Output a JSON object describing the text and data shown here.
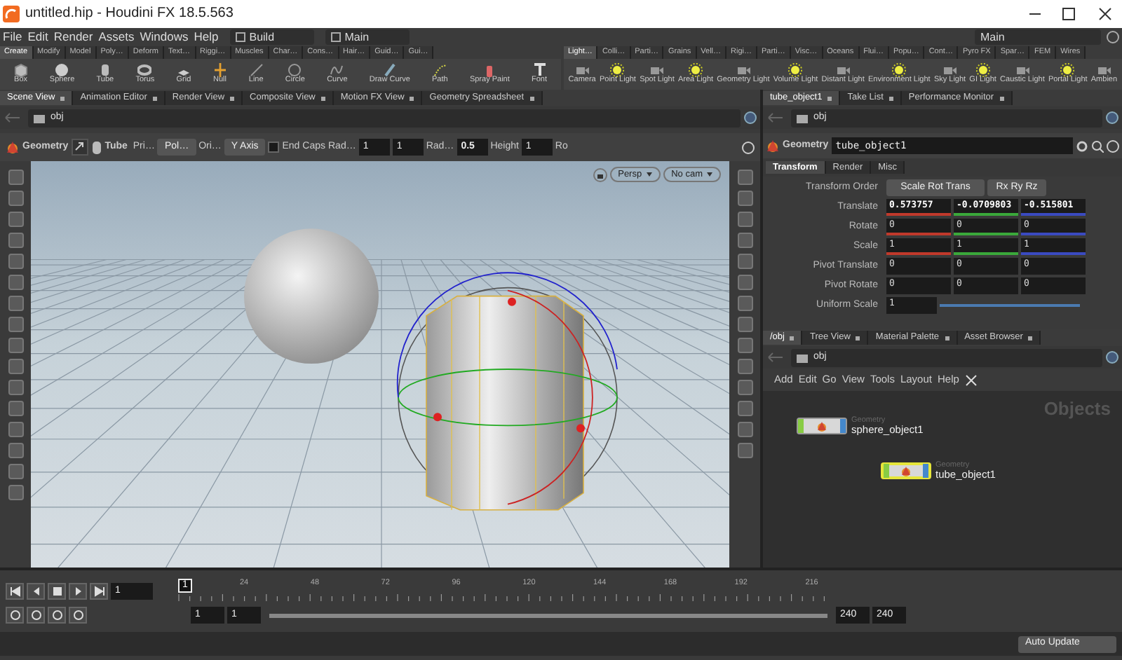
{
  "window": {
    "title": "untitled.hip - Houdini FX 18.5.563"
  },
  "menu": [
    "File",
    "Edit",
    "Render",
    "Assets",
    "Windows",
    "Help"
  ],
  "desktop_selectors": [
    {
      "label": "Build"
    },
    {
      "label": "Main"
    }
  ],
  "right_selector": {
    "label": "Main"
  },
  "shelf_left": {
    "tabs": [
      {
        "label": "Create",
        "selected": true
      },
      {
        "label": "Modify",
        "selected": false
      },
      {
        "label": "Model",
        "selected": false
      },
      {
        "label": "Poly…",
        "selected": false
      },
      {
        "label": "Deform",
        "selected": false
      },
      {
        "label": "Text…",
        "selected": false
      },
      {
        "label": "Riggi…",
        "selected": false
      },
      {
        "label": "Muscles",
        "selected": false
      },
      {
        "label": "Char…",
        "selected": false
      },
      {
        "label": "Cons…",
        "selected": false
      },
      {
        "label": "Hair…",
        "selected": false
      },
      {
        "label": "Guid…",
        "selected": false
      },
      {
        "label": "Gui…",
        "selected": false
      }
    ],
    "tools": [
      "Box",
      "Sphere",
      "Tube",
      "Torus",
      "Grid",
      "Null",
      "Line",
      "Circle",
      "Curve",
      "Draw Curve",
      "Path",
      "Spray Paint",
      "Font"
    ]
  },
  "shelf_right": {
    "tabs": [
      {
        "label": "Light…",
        "selected": true
      },
      {
        "label": "Colli…",
        "selected": false
      },
      {
        "label": "Parti…",
        "selected": false
      },
      {
        "label": "Grains",
        "selected": false
      },
      {
        "label": "Vell…",
        "selected": false
      },
      {
        "label": "Rigi…",
        "selected": false
      },
      {
        "label": "Parti…",
        "selected": false
      },
      {
        "label": "Visc…",
        "selected": false
      },
      {
        "label": "Oceans",
        "selected": false
      },
      {
        "label": "Flui…",
        "selected": false
      },
      {
        "label": "Popu…",
        "selected": false
      },
      {
        "label": "Cont…",
        "selected": false
      },
      {
        "label": "Pyro FX",
        "selected": false
      },
      {
        "label": "Spar…",
        "selected": false
      },
      {
        "label": "FEM",
        "selected": false
      },
      {
        "label": "Wires",
        "selected": false
      }
    ],
    "tools": [
      "Camera",
      "Point Light",
      "Spot Light",
      "Area Light",
      "Geometry Light",
      "Volume Light",
      "Distant Light",
      "Environment Light",
      "Sky Light",
      "GI Light",
      "Caustic Light",
      "Portal Light",
      "Ambien"
    ]
  },
  "viewer_tabs": [
    {
      "label": "Scene View",
      "selected": true
    },
    {
      "label": "Animation Editor",
      "selected": false
    },
    {
      "label": "Render View",
      "selected": false
    },
    {
      "label": "Composite View",
      "selected": false
    },
    {
      "label": "Motion FX View",
      "selected": false
    },
    {
      "label": "Geometry Spreadsheet",
      "selected": false
    }
  ],
  "viewer_path": "obj",
  "operator_toolbar": {
    "context": "Geometry",
    "tool": "Tube",
    "items": [
      {
        "kind": "label",
        "text": "Pri…"
      },
      {
        "kind": "menu",
        "text": "Pol…"
      },
      {
        "kind": "label",
        "text": "Ori…"
      },
      {
        "kind": "menu",
        "text": "Y Axis"
      },
      {
        "kind": "checkbox",
        "text": "End Caps",
        "checked": false
      },
      {
        "kind": "label",
        "text": "Rad…"
      },
      {
        "kind": "field",
        "text": "1"
      },
      {
        "kind": "field",
        "text": "1"
      },
      {
        "kind": "label",
        "text": "Rad…"
      },
      {
        "kind": "field",
        "text": "0.5"
      },
      {
        "kind": "label",
        "text": "Height"
      },
      {
        "kind": "field",
        "text": "1"
      },
      {
        "kind": "label",
        "text": "Ro"
      }
    ]
  },
  "viewport": {
    "camera_menus": [
      "Persp",
      "No cam"
    ]
  },
  "parameter_tabs": [
    {
      "label": "tube_object1",
      "selected": true
    },
    {
      "label": "Take List",
      "selected": false
    },
    {
      "label": "Performance Monitor",
      "selected": false
    }
  ],
  "parameter_path": "obj",
  "node_header": {
    "type": "Geometry",
    "name": "tube_object1"
  },
  "parameter_pages": [
    {
      "label": "Transform",
      "selected": true
    },
    {
      "label": "Render",
      "selected": false
    },
    {
      "label": "Misc",
      "selected": false
    }
  ],
  "parameters": [
    {
      "kind": "menus",
      "label": "Transform Order",
      "values": [
        "Scale Rot Trans",
        "Rx Ry Rz"
      ]
    },
    {
      "kind": "vector",
      "label": "Translate",
      "values": [
        "0.573757",
        "-0.0709803",
        "-0.515801"
      ],
      "modified": true,
      "colored": true
    },
    {
      "kind": "vector",
      "label": "Rotate",
      "values": [
        "0",
        "0",
        "0"
      ],
      "modified": false,
      "colored": true
    },
    {
      "kind": "vector",
      "label": "Scale",
      "values": [
        "1",
        "1",
        "1"
      ],
      "modified": false,
      "colored": true
    },
    {
      "kind": "vector",
      "label": "Pivot Translate",
      "values": [
        "0",
        "0",
        "0"
      ],
      "modified": false,
      "colored": false
    },
    {
      "kind": "vector",
      "label": "Pivot Rotate",
      "values": [
        "0",
        "0",
        "0"
      ],
      "modified": false,
      "colored": false
    },
    {
      "kind": "slider",
      "label": "Uniform Scale",
      "values": [
        "1"
      ],
      "level": 1.0
    }
  ],
  "network_tabs": [
    {
      "label": "/obj",
      "selected": true
    },
    {
      "label": "Tree View",
      "selected": false
    },
    {
      "label": "Material Palette",
      "selected": false
    },
    {
      "label": "Asset Browser",
      "selected": false
    }
  ],
  "network_path": "obj",
  "network_menu": [
    "Add",
    "Edit",
    "Go",
    "View",
    "Tools",
    "Layout",
    "Help"
  ],
  "network": {
    "context_label": "Objects",
    "nodes": [
      {
        "type": "Geometry",
        "name": "sphere_object1",
        "selected": false
      },
      {
        "type": "Geometry",
        "name": "tube_object1",
        "selected": true
      }
    ]
  },
  "timeline": {
    "current_frame": "1",
    "marker": "1",
    "ticks": [
      "24",
      "48",
      "72",
      "96",
      "120",
      "144",
      "168",
      "192",
      "216"
    ]
  },
  "range": {
    "level": 1.0,
    "start": "1",
    "current_start": "1",
    "end": "240",
    "current_end": "240"
  },
  "status_bar": {
    "update_mode": "Auto Update"
  }
}
